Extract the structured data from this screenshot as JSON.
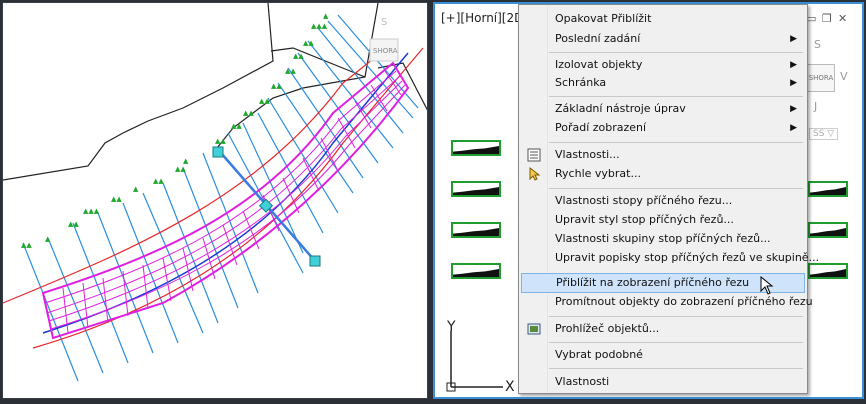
{
  "left_viewport": {
    "view_cube_label": "SHORA"
  },
  "right_viewport": {
    "label": "[+][Horní][2D d",
    "view_cube_label": "SHORA",
    "axis_y": "Y",
    "axis_x": "X"
  },
  "context_menu": {
    "items": [
      {
        "label": "Opakovat Přiblížit",
        "submenu": false
      },
      {
        "label": "Poslední zadání",
        "submenu": true
      },
      {
        "label": "Izolovat objekty",
        "submenu": true
      },
      {
        "label": "Schránka",
        "submenu": true
      },
      {
        "label": "Základní nástroje úprav",
        "submenu": true
      },
      {
        "label": "Pořadí zobrazení",
        "submenu": true
      },
      {
        "label": "Vlastnosti...",
        "icon": "properties-icon"
      },
      {
        "label": "Rychle vybrat...",
        "icon": "quick-select-icon"
      },
      {
        "label": "Vlastnosti stopy příčného řezu..."
      },
      {
        "label": "Upravit styl stop příčných řezů..."
      },
      {
        "label": "Vlastnosti skupiny stop příčných řezů..."
      },
      {
        "label": "Upravit popisky stop příčných řezů ve skupině..."
      },
      {
        "label": "Přiblížit na zobrazení příčného řezu",
        "highlighted": true
      },
      {
        "label": "Promítnout objekty do zobrazení příčného řezu"
      },
      {
        "label": "Prohlížeč objektů...",
        "icon": "object-viewer-icon"
      },
      {
        "label": "Vybrat podobné"
      },
      {
        "label": "Vlastnosti"
      }
    ]
  },
  "colors": {
    "alignment": "#e8262a",
    "corridor": "#e020e0",
    "sample_lines": "#2a8ee0",
    "labels": "#1fa82f",
    "highlight": "#cfe3fb"
  }
}
